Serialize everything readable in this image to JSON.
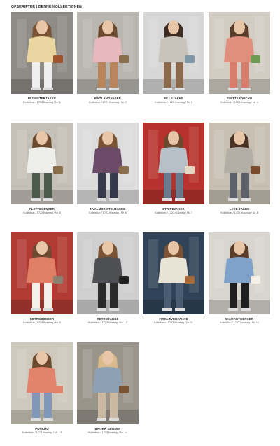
{
  "heading": "OPSKRIFTER I DENNE KOLLEKTIONEN",
  "items": [
    {
      "name": "BLOMSTERJAKKE",
      "sub": "Kollektion / 1723 Ifosetag / Nr. 1",
      "bg": "#8f8b86",
      "top": "#e9d6a0",
      "bottom": "#efefef",
      "hair": "#7a5234",
      "accent": "#a0522d"
    },
    {
      "name": "RAGLANGENSER",
      "sub": "Kollektion / 1723 Ifosetag / Nr. 2",
      "bg": "#b9b6b0",
      "top": "#e7b9bf",
      "bottom": "#b8865a",
      "hair": "#6b4a30",
      "accent": "#8a6e4b"
    },
    {
      "name": "BILLEJAKKE",
      "sub": "Kollektion / 1723 Ifosetag / Nr. 3",
      "bg": "#d7d7d7",
      "top": "#c9c4bb",
      "bottom": "#8c6a4e",
      "hair": "#3e2c22",
      "accent": "#7f98a8"
    },
    {
      "name": "FLETTEPONCHO",
      "sub": "Kollektion / 1723 Ifosetag / Nr. 4",
      "bg": "#d2ccc3",
      "top": "#e08f7f",
      "bottom": "#d77d6c",
      "hair": "#5a3c2a",
      "accent": "#6e9a52"
    },
    {
      "name": "FLETTEGENSER",
      "sub": "Kollektion / 1723 Ifosetag / Nr. 5",
      "bg": "#c5c0b7",
      "top": "#eeeeea",
      "bottom": "#4b5a4a",
      "hair": "#6b4a30",
      "accent": "#8a6e4b"
    },
    {
      "name": "HVALMBRISTENJAKKE",
      "sub": "Kollektion / 1723 Ifosetag / Nr. 6",
      "bg": "#dcdcdc",
      "top": "#6a4a66",
      "bottom": "#35394a",
      "hair": "#7a5234",
      "accent": "#8a6e4b"
    },
    {
      "name": "STRIPEJAKKE",
      "sub": "Kollektion / 1723 Ifosetag / Nr. 7",
      "bg": "#b7322c",
      "top": "#b8c1c7",
      "bottom": "#6a7a8c",
      "hair": "#6b4a30",
      "accent": "#e5d8c4"
    },
    {
      "name": "LACE JAKKE",
      "sub": "Kollektion / 1723 Ifosetag / Nr. 8",
      "bg": "#c8c0b3",
      "top": "#b4afa6",
      "bottom": "#5c6068",
      "hair": "#4a3426",
      "accent": "#7a4a2e"
    },
    {
      "name": "RETROGENSER",
      "sub": "Kollektion / 1723 Ifosetag / Nr. 9",
      "bg": "#b13a33",
      "top": "#e07f66",
      "bottom": "#f2f0ea",
      "hair": "#6b4a30",
      "accent": "#8c8170"
    },
    {
      "name": "RETROJAKKE",
      "sub": "Kollektion / 1723 Ifosetag / Nr. 10",
      "bg": "#cfcfcf",
      "top": "#4d4f52",
      "bottom": "#2a2a2a",
      "hair": "#7a5234",
      "accent": "#1f1f1f"
    },
    {
      "name": "FIRKLØVERJAKKE",
      "sub": "Kollektion / 1723 Ifosetag / Nr. 11",
      "bg": "#2f4257",
      "top": "#e9e3d6",
      "bottom": "#4a5c72",
      "hair": "#7a5234",
      "accent": "#a76a3a"
    },
    {
      "name": "DIAMANTGENSER",
      "sub": "Kollektion / 1723 Ifosetag / Nr. 12",
      "bg": "#d8d5cf",
      "top": "#7ea2c9",
      "bottom": "#1f1f1f",
      "hair": "#5a3c2a",
      "accent": "#f4efe4"
    },
    {
      "name": "PONCHO",
      "sub": "Kollektion / 1723 Ifosetag / Nr. 13",
      "bg": "#cfc8bc",
      "top": "#e2846c",
      "bottom": "#7f98b7",
      "hair": "#6b4a30",
      "accent": "#e2846c"
    },
    {
      "name": "BATIKK GENSER",
      "sub": "Kollektion / 1723 Ifosetag / Nr. 14",
      "bg": "#9a948b",
      "top": "#8ea0b3",
      "bottom": "#c9b9a2",
      "hair": "#d7b98a",
      "accent": "#7a5234"
    }
  ]
}
